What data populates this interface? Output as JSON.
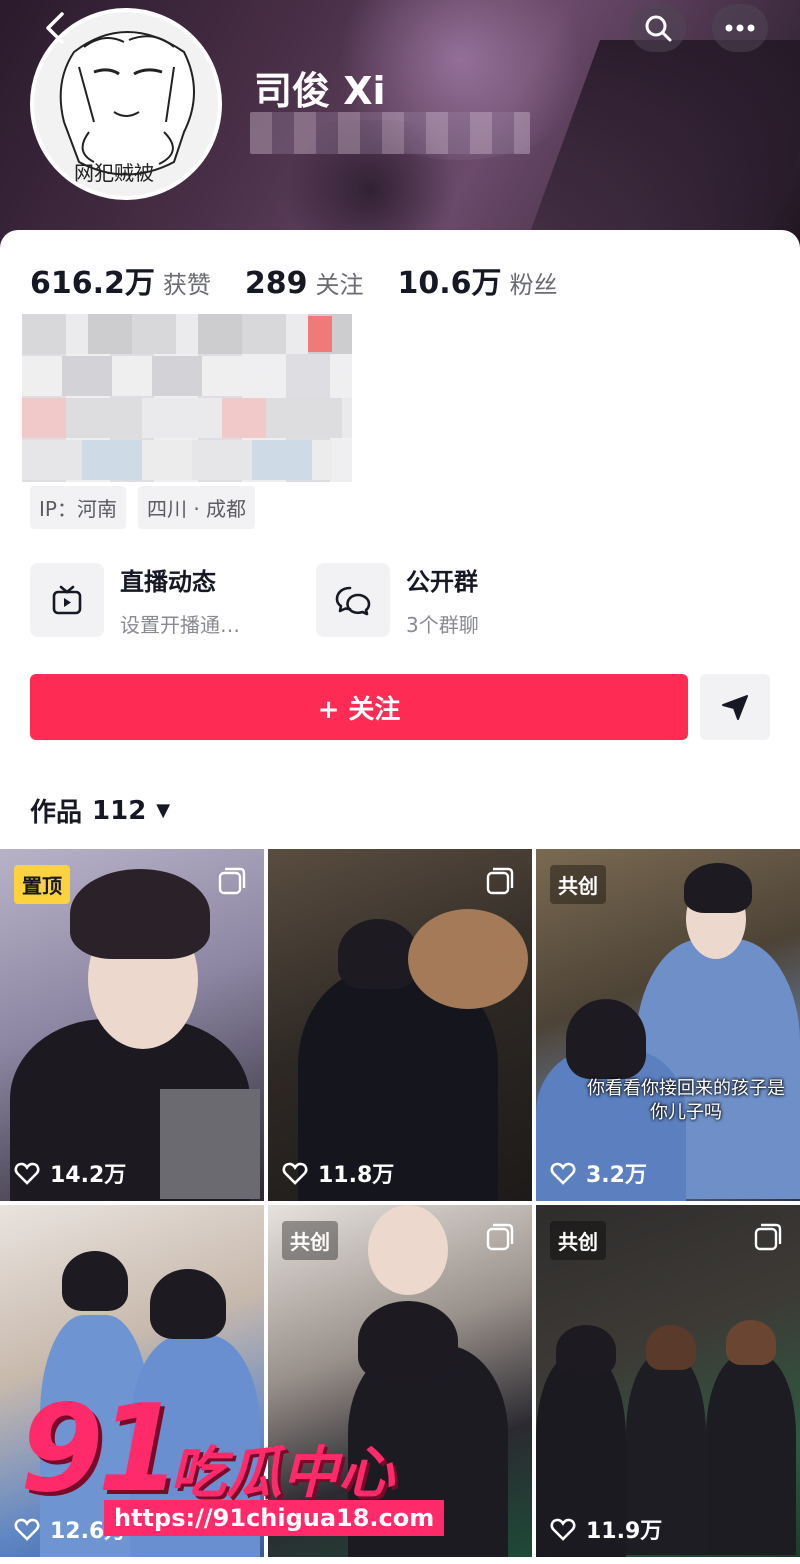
{
  "profile": {
    "name": "司俊 Xi",
    "avatar_text": "网犯贼被",
    "stats": [
      {
        "num": "616.2万",
        "label": "获赞"
      },
      {
        "num": "289",
        "label": "关注"
      },
      {
        "num": "10.6万",
        "label": "粉丝"
      }
    ],
    "tags": [
      "IP：河南",
      "四川 · 成都"
    ]
  },
  "features": {
    "live": {
      "title": "直播动态",
      "sub": "设置开播通…"
    },
    "group": {
      "title": "公开群",
      "sub": "3个群聊"
    }
  },
  "actions": {
    "follow_label": "+ 关注"
  },
  "works": {
    "label": "作品",
    "count": "112"
  },
  "tiles": [
    {
      "badge": "置顶",
      "likes": "14.2万",
      "caption": ""
    },
    {
      "badge": "",
      "likes": "11.8万",
      "caption": ""
    },
    {
      "badge": "共创",
      "likes": "3.2万",
      "caption": "你看看你接回来的孩子是你儿子吗"
    },
    {
      "badge": "",
      "likes": "12.6万",
      "caption": ""
    },
    {
      "badge": "共创",
      "likes": "",
      "caption": ""
    },
    {
      "badge": "共创",
      "likes": "11.9万",
      "caption": ""
    }
  ],
  "watermark": {
    "number": "91",
    "text": "吃瓜中心",
    "url": "https://91chigua18.com"
  },
  "colors": {
    "accent": "#fe2c55",
    "pin_badge": "#fcd23d",
    "watermark": "#ff2a6a"
  }
}
